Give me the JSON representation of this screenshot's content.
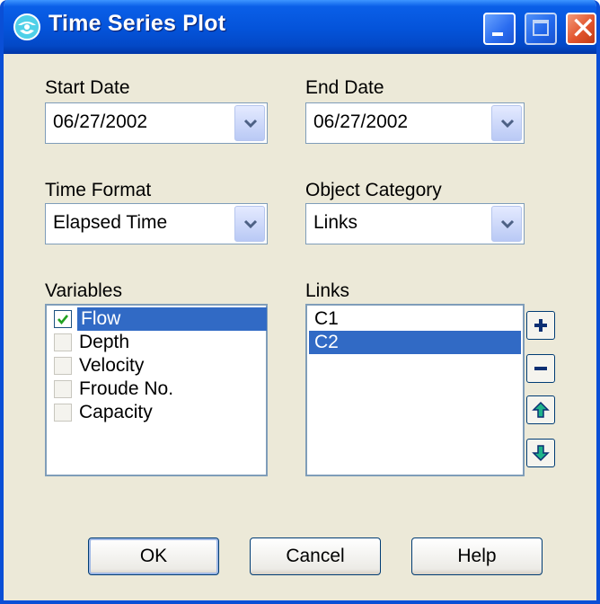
{
  "window": {
    "title": "Time Series Plot"
  },
  "start_date": {
    "label": "Start Date",
    "value": "06/27/2002"
  },
  "end_date": {
    "label": "End Date",
    "value": "06/27/2002"
  },
  "time_format": {
    "label": "Time Format",
    "value": "Elapsed Time"
  },
  "object_category": {
    "label": "Object Category",
    "value": "Links"
  },
  "variables": {
    "label": "Variables",
    "items": [
      {
        "name": "Flow",
        "checked": true,
        "selected": true
      },
      {
        "name": "Depth",
        "checked": false,
        "selected": false
      },
      {
        "name": "Velocity",
        "checked": false,
        "selected": false
      },
      {
        "name": "Froude No.",
        "checked": false,
        "selected": false
      },
      {
        "name": "Capacity",
        "checked": false,
        "selected": false
      }
    ]
  },
  "links": {
    "label": "Links",
    "items": [
      {
        "name": "C1",
        "selected": false
      },
      {
        "name": "C2",
        "selected": true
      }
    ]
  },
  "side_buttons": [
    "plus-icon",
    "minus-icon",
    "arrow-up-icon",
    "arrow-down-icon"
  ],
  "buttons": {
    "ok": "OK",
    "cancel": "Cancel",
    "help": "Help"
  },
  "colors": {
    "titlebar": "#0453d9",
    "selection": "#316ac5",
    "dialog_bg": "#ece9d8"
  }
}
